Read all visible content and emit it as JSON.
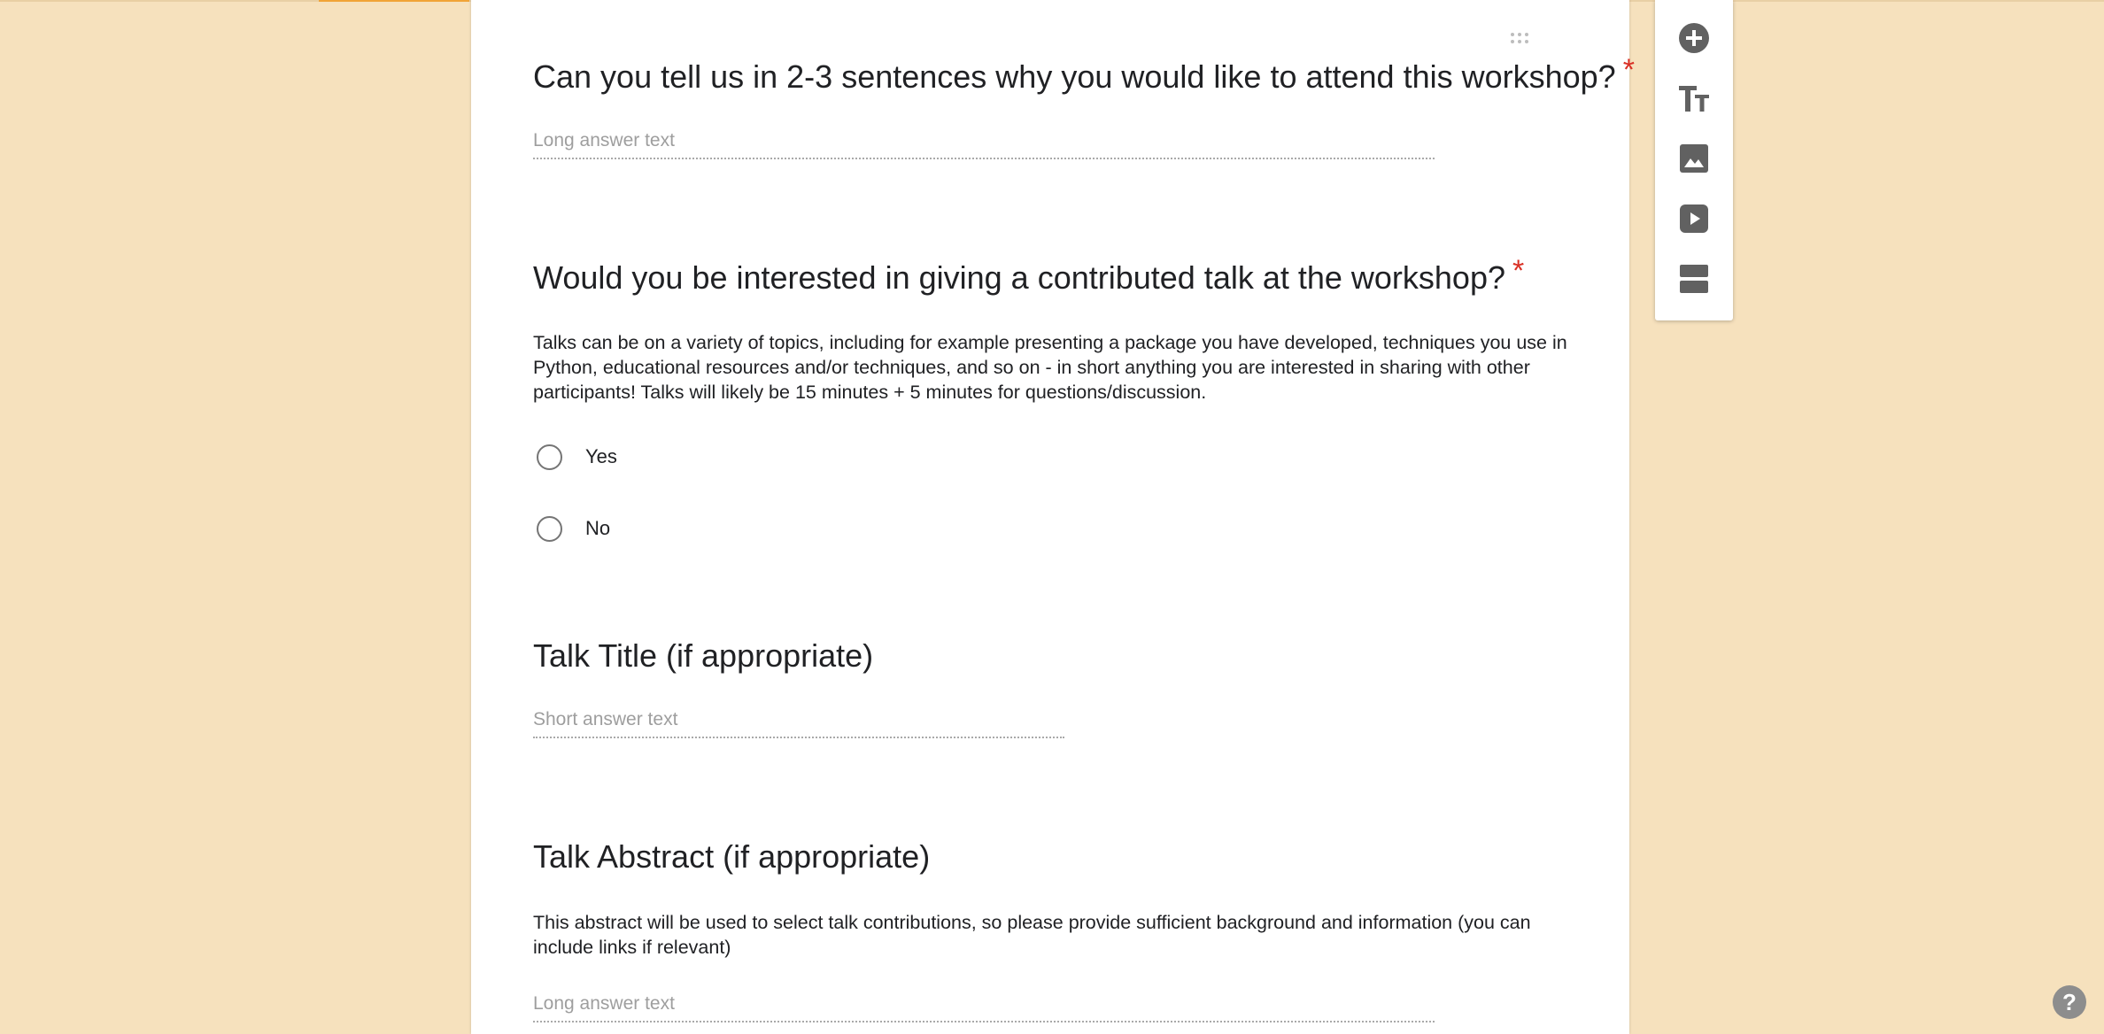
{
  "form": {
    "questions": [
      {
        "title": "Can you tell us in 2-3 sentences why you would like to attend this workshop?",
        "required_mark": "*",
        "answer_placeholder": "Long answer text"
      },
      {
        "title": "Would you be interested in giving a contributed talk at the workshop?",
        "required_mark": "*",
        "description": "Talks can be on a variety of topics, including for example presenting a package you have developed, techniques you use in Python, educational resources and/or techniques, and so on - in short anything you are interested in sharing with other participants! Talks will likely be 15 minutes + 5 minutes for questions/discussion.",
        "options": [
          "Yes",
          "No"
        ]
      },
      {
        "title": "Talk Title (if appropriate)",
        "answer_placeholder": "Short answer text"
      },
      {
        "title": "Talk Abstract (if appropriate)",
        "description": "This abstract will be used to select talk contributions, so please provide sufficient background and information (you can include links if relevant)",
        "answer_placeholder": "Long answer text"
      }
    ]
  },
  "toolbar": {
    "items": [
      "add-question-icon",
      "add-title-icon",
      "add-image-icon",
      "add-video-icon",
      "add-section-icon"
    ]
  },
  "help": {
    "label": "?"
  },
  "colors": {
    "background": "#f6e1bd",
    "card": "#ffffff",
    "required": "#d93025",
    "icon": "#616161"
  }
}
